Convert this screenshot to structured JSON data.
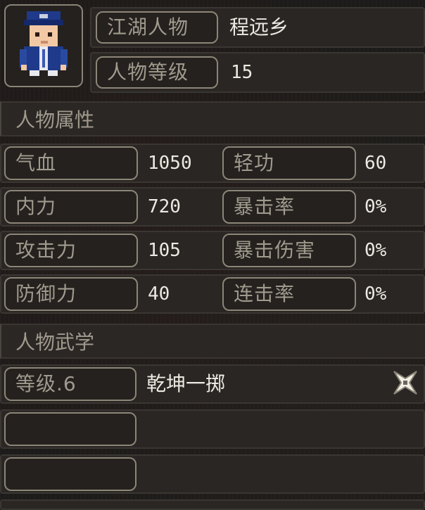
{
  "profile": {
    "name_label": "江湖人物",
    "name_value": "程远乡",
    "level_label": "人物等级",
    "level_value": "15"
  },
  "attributes": {
    "title": "人物属性",
    "items": [
      {
        "label": "气血",
        "value": "1050"
      },
      {
        "label": "轻功",
        "value": "60"
      },
      {
        "label": "内力",
        "value": "720"
      },
      {
        "label": "暴击率",
        "value": "0%"
      },
      {
        "label": "攻击力",
        "value": "105"
      },
      {
        "label": "暴击伤害",
        "value": "0%"
      },
      {
        "label": "防御力",
        "value": "40"
      },
      {
        "label": "连击率",
        "value": "0%"
      }
    ]
  },
  "martial": {
    "title": "人物武学",
    "skills": [
      {
        "level_label": "等级.6",
        "name": "乾坤一掷",
        "icon": "shuriken-icon"
      },
      {
        "level_label": "",
        "name": ""
      },
      {
        "level_label": "",
        "name": ""
      }
    ]
  },
  "colors": {
    "background": "#1d1b19",
    "tag_border": "#8c8678",
    "label_text": "#a09a8e",
    "value_text": "#ece9e2"
  }
}
